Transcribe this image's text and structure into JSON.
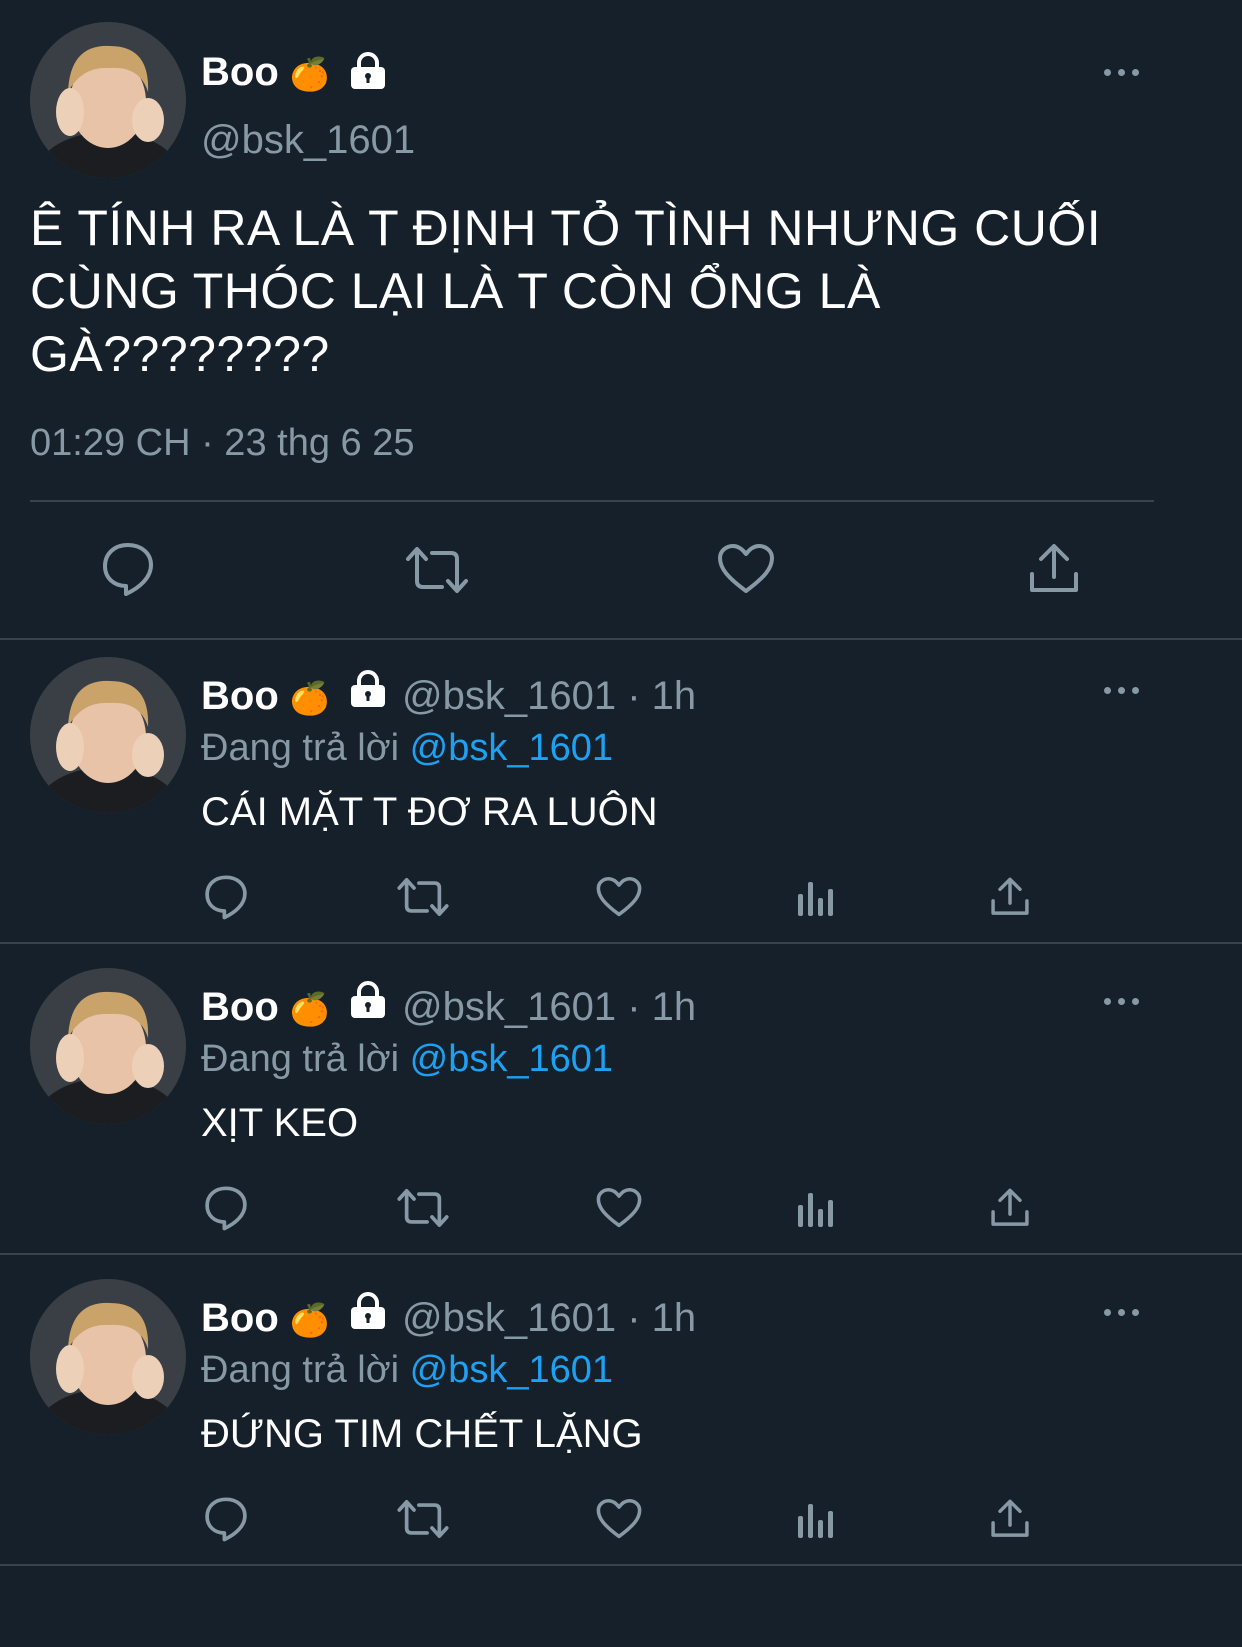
{
  "main_tweet": {
    "display_name": "Boo",
    "name_emoji": "🍊",
    "handle": "@bsk_1601",
    "text": "Ê TÍNH RA LÀ T ĐỊNH TỎ TÌNH NHƯNG CUỐI CÙNG THÓC LẠI LÀ T CÒN ỔNG LÀ GÀ????????",
    "timestamp": "01:29 CH · 23 thg 6 25",
    "actions": [
      "reply-icon",
      "retweet-icon",
      "like-icon",
      "share-icon"
    ]
  },
  "replies": [
    {
      "display_name": "Boo",
      "name_emoji": "🍊",
      "handle_time": "@bsk_1601 · 1h",
      "replying_prefix": "Đang trả lời",
      "replying_to": "@bsk_1601",
      "text": "CÁI MẶT T ĐƠ RA LUÔN"
    },
    {
      "display_name": "Boo",
      "name_emoji": "🍊",
      "handle_time": "@bsk_1601 · 1h",
      "replying_prefix": "Đang trả lời",
      "replying_to": "@bsk_1601",
      "text": "XỊT KEO"
    },
    {
      "display_name": "Boo",
      "name_emoji": "🍊",
      "handle_time": "@bsk_1601 · 1h",
      "replying_prefix": "Đang trả lời",
      "replying_to": "@bsk_1601",
      "text": "ĐỨNG TIM CHẾT LẶNG"
    }
  ],
  "colors": {
    "background": "#15202b",
    "text": "#ffffff",
    "secondary": "#8899a6",
    "link": "#1da1f2",
    "divider": "#38444d"
  }
}
